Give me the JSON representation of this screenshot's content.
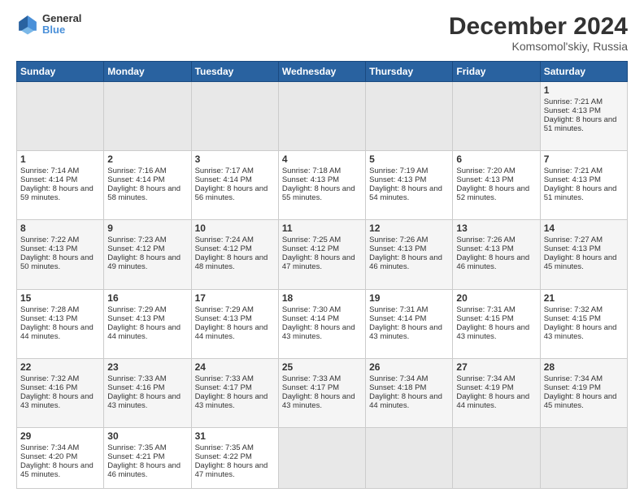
{
  "header": {
    "logo": {
      "line1": "General",
      "line2": "Blue"
    },
    "title": "December 2024",
    "subtitle": "Komsomol'skiy, Russia"
  },
  "calendar": {
    "days_of_week": [
      "Sunday",
      "Monday",
      "Tuesday",
      "Wednesday",
      "Thursday",
      "Friday",
      "Saturday"
    ],
    "weeks": [
      [
        null,
        null,
        null,
        null,
        null,
        null,
        {
          "day": "1",
          "sunrise": "7:21 AM",
          "sunset": "4:13 PM",
          "daylight": "8 hours and 51 minutes."
        }
      ],
      [
        {
          "day": "1",
          "sunrise": "7:14 AM",
          "sunset": "4:14 PM",
          "daylight": "8 hours and 59 minutes."
        },
        {
          "day": "2",
          "sunrise": "7:16 AM",
          "sunset": "4:14 PM",
          "daylight": "8 hours and 58 minutes."
        },
        {
          "day": "3",
          "sunrise": "7:17 AM",
          "sunset": "4:14 PM",
          "daylight": "8 hours and 56 minutes."
        },
        {
          "day": "4",
          "sunrise": "7:18 AM",
          "sunset": "4:13 PM",
          "daylight": "8 hours and 55 minutes."
        },
        {
          "day": "5",
          "sunrise": "7:19 AM",
          "sunset": "4:13 PM",
          "daylight": "8 hours and 54 minutes."
        },
        {
          "day": "6",
          "sunrise": "7:20 AM",
          "sunset": "4:13 PM",
          "daylight": "8 hours and 52 minutes."
        },
        {
          "day": "7",
          "sunrise": "7:21 AM",
          "sunset": "4:13 PM",
          "daylight": "8 hours and 51 minutes."
        }
      ],
      [
        {
          "day": "8",
          "sunrise": "7:22 AM",
          "sunset": "4:13 PM",
          "daylight": "8 hours and 50 minutes."
        },
        {
          "day": "9",
          "sunrise": "7:23 AM",
          "sunset": "4:12 PM",
          "daylight": "8 hours and 49 minutes."
        },
        {
          "day": "10",
          "sunrise": "7:24 AM",
          "sunset": "4:12 PM",
          "daylight": "8 hours and 48 minutes."
        },
        {
          "day": "11",
          "sunrise": "7:25 AM",
          "sunset": "4:12 PM",
          "daylight": "8 hours and 47 minutes."
        },
        {
          "day": "12",
          "sunrise": "7:26 AM",
          "sunset": "4:13 PM",
          "daylight": "8 hours and 46 minutes."
        },
        {
          "day": "13",
          "sunrise": "7:26 AM",
          "sunset": "4:13 PM",
          "daylight": "8 hours and 46 minutes."
        },
        {
          "day": "14",
          "sunrise": "7:27 AM",
          "sunset": "4:13 PM",
          "daylight": "8 hours and 45 minutes."
        }
      ],
      [
        {
          "day": "15",
          "sunrise": "7:28 AM",
          "sunset": "4:13 PM",
          "daylight": "8 hours and 44 minutes."
        },
        {
          "day": "16",
          "sunrise": "7:29 AM",
          "sunset": "4:13 PM",
          "daylight": "8 hours and 44 minutes."
        },
        {
          "day": "17",
          "sunrise": "7:29 AM",
          "sunset": "4:13 PM",
          "daylight": "8 hours and 44 minutes."
        },
        {
          "day": "18",
          "sunrise": "7:30 AM",
          "sunset": "4:14 PM",
          "daylight": "8 hours and 43 minutes."
        },
        {
          "day": "19",
          "sunrise": "7:31 AM",
          "sunset": "4:14 PM",
          "daylight": "8 hours and 43 minutes."
        },
        {
          "day": "20",
          "sunrise": "7:31 AM",
          "sunset": "4:15 PM",
          "daylight": "8 hours and 43 minutes."
        },
        {
          "day": "21",
          "sunrise": "7:32 AM",
          "sunset": "4:15 PM",
          "daylight": "8 hours and 43 minutes."
        }
      ],
      [
        {
          "day": "22",
          "sunrise": "7:32 AM",
          "sunset": "4:16 PM",
          "daylight": "8 hours and 43 minutes."
        },
        {
          "day": "23",
          "sunrise": "7:33 AM",
          "sunset": "4:16 PM",
          "daylight": "8 hours and 43 minutes."
        },
        {
          "day": "24",
          "sunrise": "7:33 AM",
          "sunset": "4:17 PM",
          "daylight": "8 hours and 43 minutes."
        },
        {
          "day": "25",
          "sunrise": "7:33 AM",
          "sunset": "4:17 PM",
          "daylight": "8 hours and 43 minutes."
        },
        {
          "day": "26",
          "sunrise": "7:34 AM",
          "sunset": "4:18 PM",
          "daylight": "8 hours and 44 minutes."
        },
        {
          "day": "27",
          "sunrise": "7:34 AM",
          "sunset": "4:19 PM",
          "daylight": "8 hours and 44 minutes."
        },
        {
          "day": "28",
          "sunrise": "7:34 AM",
          "sunset": "4:19 PM",
          "daylight": "8 hours and 45 minutes."
        }
      ],
      [
        {
          "day": "29",
          "sunrise": "7:34 AM",
          "sunset": "4:20 PM",
          "daylight": "8 hours and 45 minutes."
        },
        {
          "day": "30",
          "sunrise": "7:35 AM",
          "sunset": "4:21 PM",
          "daylight": "8 hours and 46 minutes."
        },
        {
          "day": "31",
          "sunrise": "7:35 AM",
          "sunset": "4:22 PM",
          "daylight": "8 hours and 47 minutes."
        },
        null,
        null,
        null,
        null
      ]
    ]
  }
}
